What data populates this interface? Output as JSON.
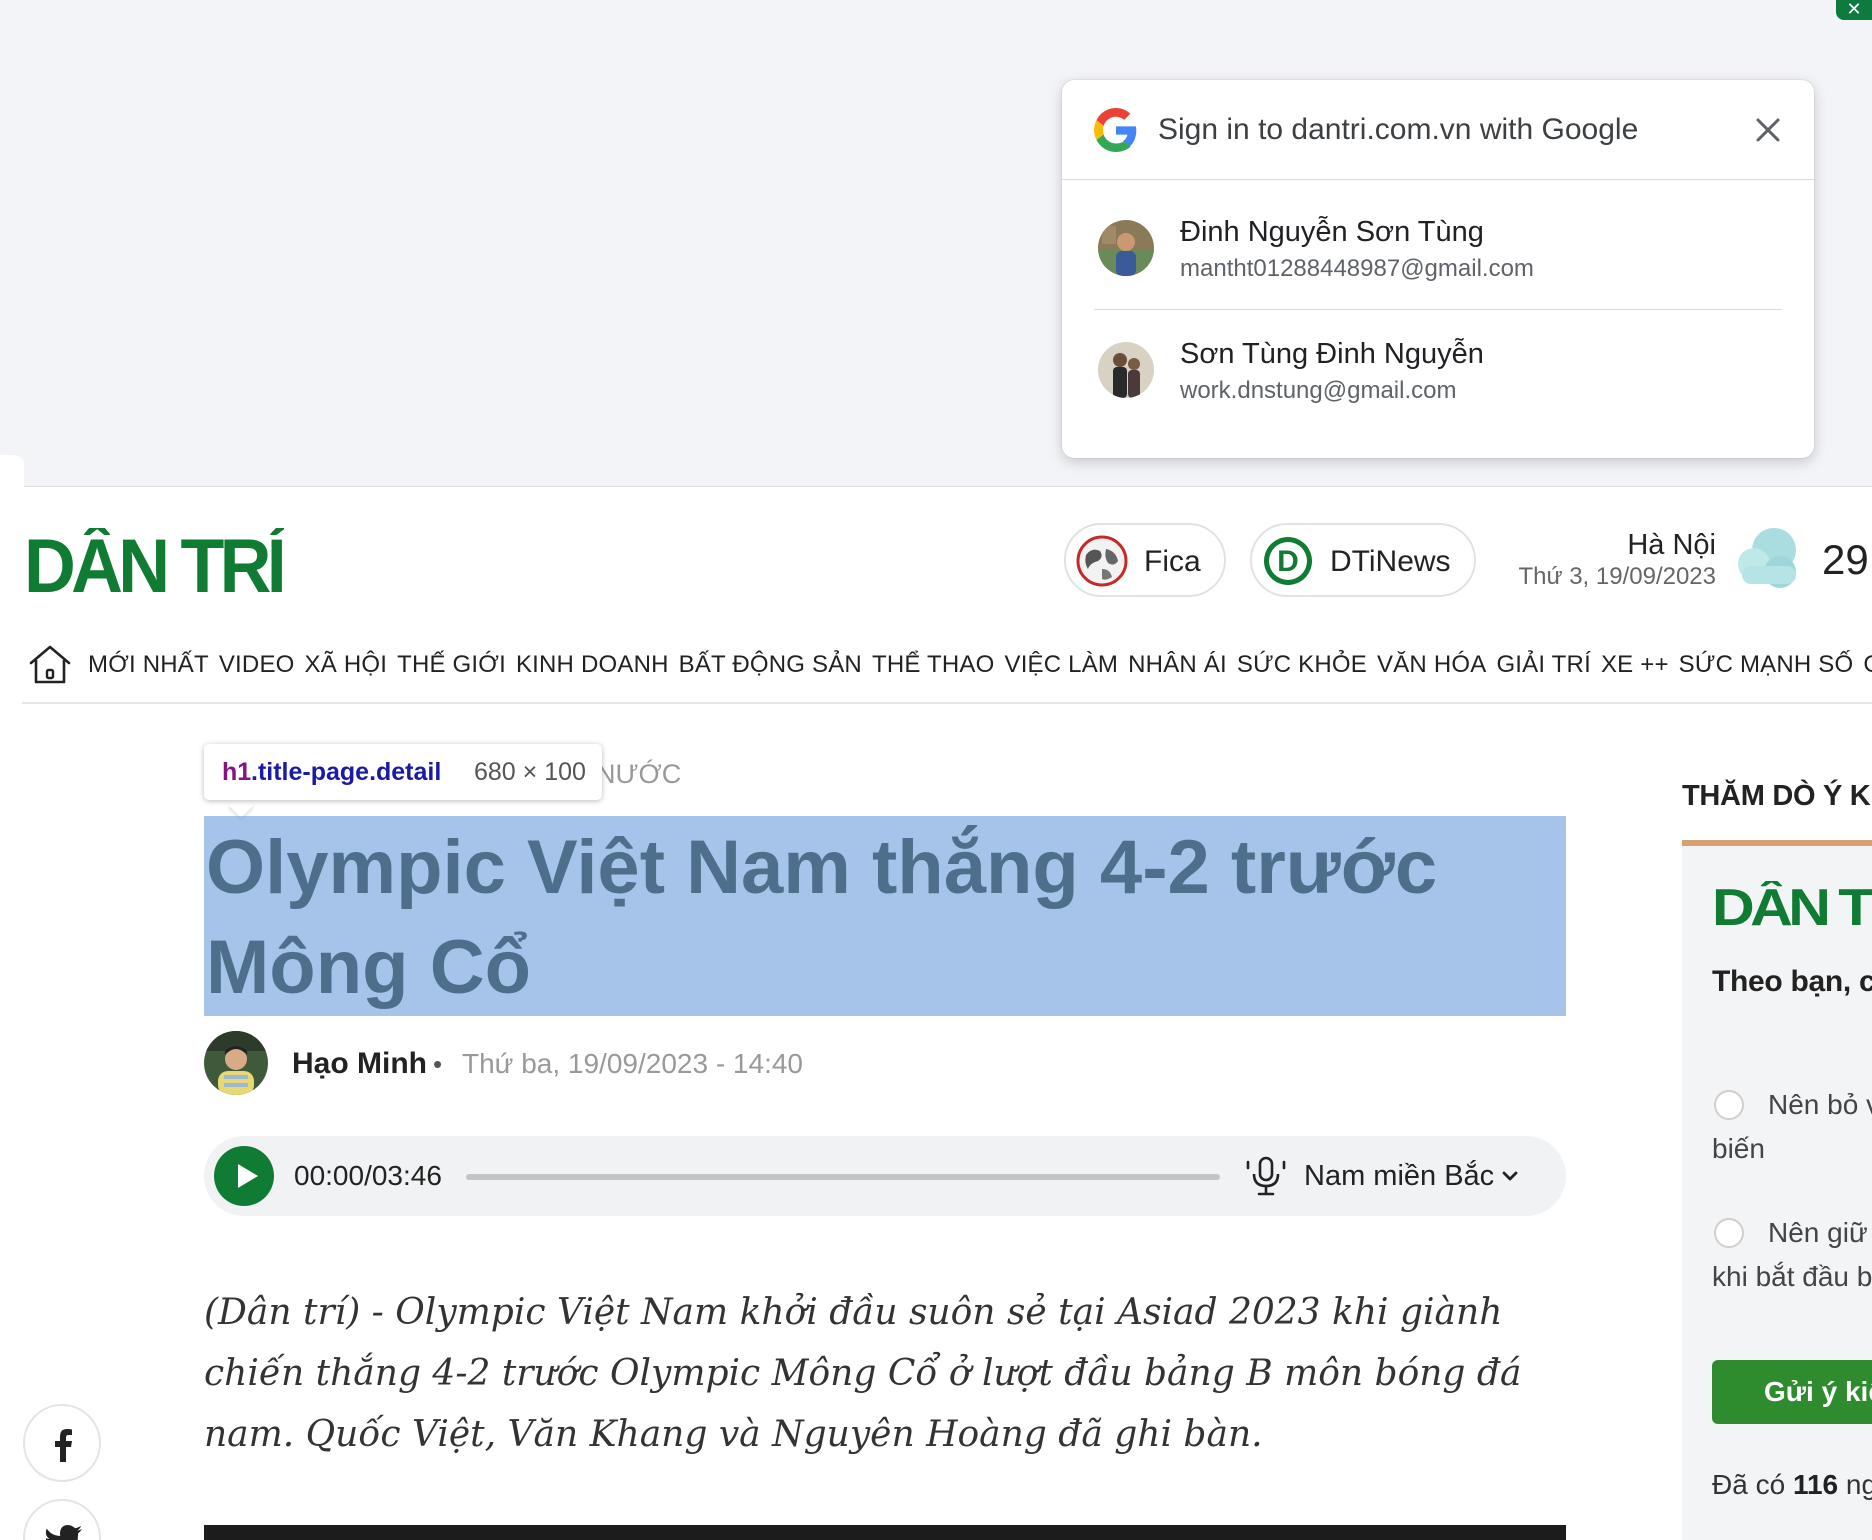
{
  "google_signin": {
    "title": "Sign in to dantri.com.vn with Google",
    "accounts": [
      {
        "name": "Đinh Nguyễn Sơn Tùng",
        "email": "mantht01288448987@gmail.com"
      },
      {
        "name": "Sơn Tùng Đinh Nguyễn",
        "email": "work.dnstung@gmail.com"
      }
    ]
  },
  "header": {
    "logo_text": "DÂN TRÍ",
    "pills": {
      "fica": "Fica",
      "dtinews": "DTiNews"
    },
    "weather": {
      "city": "Hà Nội",
      "date": "Thứ 3, 19/09/2023",
      "temp": "29",
      "icon": "cloud-icon"
    }
  },
  "nav": {
    "items": [
      "MỚI NHẤT",
      "VIDEO",
      "XÃ HỘI",
      "THẾ GIỚI",
      "KINH DOANH",
      "BẤT ĐỘNG SẢN",
      "THỂ THAO",
      "VIỆC LÀM",
      "NHÂN ÁI",
      "SỨC KHỎE",
      "VĂN HÓA",
      "GIẢI TRÍ",
      "XE ++",
      "SỨC MẠNH SỐ",
      "GI"
    ]
  },
  "inspector_tooltip": {
    "tag": "h1",
    "class": ".title-page.detail",
    "size": "680 × 100"
  },
  "article": {
    "breadcrumb": "NƯỚC",
    "title": "Olympic Việt Nam thắng 4-2 trước Mông Cổ",
    "author": "Hạo Minh",
    "separator": "•",
    "published": "Thứ ba, 19/09/2023 - 14:40",
    "audio": {
      "time": "00:00/03:46",
      "voice": "Nam miền Bắc",
      "progress": 0
    },
    "sapo": "(Dân trí) - Olympic Việt Nam khởi đầu suôn sẻ tại Asiad 2023 khi giành chiến thắng 4-2 trước Olympic Mông Cổ ở lượt đầu bảng B môn bóng đá nam. Quốc Việt, Văn Khang và Nguyên Hoàng đã ghi bàn."
  },
  "poll": {
    "heading": "THĂM DÒ Ý KI",
    "logo_text": "DÂN TR",
    "question": "Theo bạn, cá thức \"kiểm t",
    "options": [
      {
        "line1": "Nên bỏ v",
        "line2": "biến"
      },
      {
        "line1": "Nên giữ",
        "line2": "khi bắt đầu b"
      }
    ],
    "submit_label": "Gửi ý kiế",
    "count_prefix": "Đã có",
    "count": "116",
    "count_suffix": "ng"
  },
  "colors": {
    "brand_green": "#0f7b33",
    "highlight": "#6fa0dc",
    "poll_button": "#2e8b2e",
    "poll_accent": "#d6a071"
  }
}
